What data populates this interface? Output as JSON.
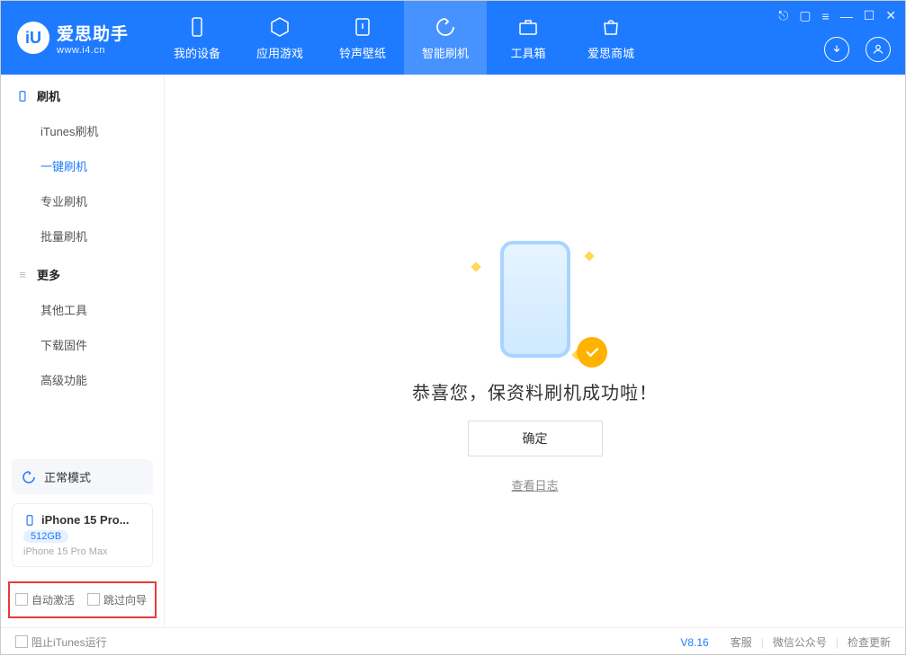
{
  "app": {
    "title": "爱思助手",
    "subtitle": "www.i4.cn"
  },
  "nav": {
    "items": [
      {
        "label": "我的设备",
        "icon": "device"
      },
      {
        "label": "应用游戏",
        "icon": "cube"
      },
      {
        "label": "铃声壁纸",
        "icon": "music"
      },
      {
        "label": "智能刷机",
        "icon": "refresh",
        "active": true
      },
      {
        "label": "工具箱",
        "icon": "toolbox"
      },
      {
        "label": "爱思商城",
        "icon": "bag"
      }
    ]
  },
  "sidebar": {
    "group1_title": "刷机",
    "group1_items": [
      "iTunes刷机",
      "一键刷机",
      "专业刷机",
      "批量刷机"
    ],
    "group1_active_index": 1,
    "group2_title": "更多",
    "group2_items": [
      "其他工具",
      "下载固件",
      "高级功能"
    ]
  },
  "mode": {
    "label": "正常模式"
  },
  "device": {
    "name": "iPhone 15 Pro...",
    "storage": "512GB",
    "full": "iPhone 15 Pro Max"
  },
  "options": {
    "auto_activate": "自动激活",
    "skip_guide": "跳过向导"
  },
  "main": {
    "success_text": "恭喜您，保资料刷机成功啦！",
    "ok_button": "确定",
    "view_log": "查看日志"
  },
  "footer": {
    "block_itunes": "阻止iTunes运行",
    "version": "V8.16",
    "links": [
      "客服",
      "微信公众号",
      "检查更新"
    ]
  }
}
